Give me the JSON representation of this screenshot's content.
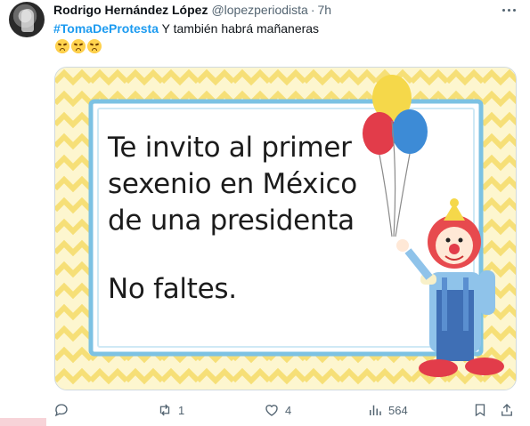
{
  "tweet": {
    "author_name": "Rodrigo Hernández López",
    "handle": "@lopezperiodista",
    "separator": "·",
    "time": "7h",
    "hashtag": "#TomaDeProtesta",
    "text": " Y también habrá mañaneras",
    "emojis": [
      "tired-face-emoji",
      "confounded-face-emoji",
      "confounded-face-emoji"
    ]
  },
  "media": {
    "lines": [
      "Te invito al primer",
      "sexenio en México",
      "de una presidenta"
    ],
    "closing": "No faltes.",
    "colors": {
      "chevron_yellow": "#f6df77",
      "background": "#fdf6cf",
      "frame_blue": "#7cc2e3",
      "card_white": "#ffffff"
    }
  },
  "actions": {
    "reply_count": "",
    "retweet_count": "1",
    "like_count": "4",
    "view_count": "564"
  },
  "colors": {
    "accent": "#1d9bf0",
    "muted": "#536471",
    "text": "#0f1419"
  }
}
